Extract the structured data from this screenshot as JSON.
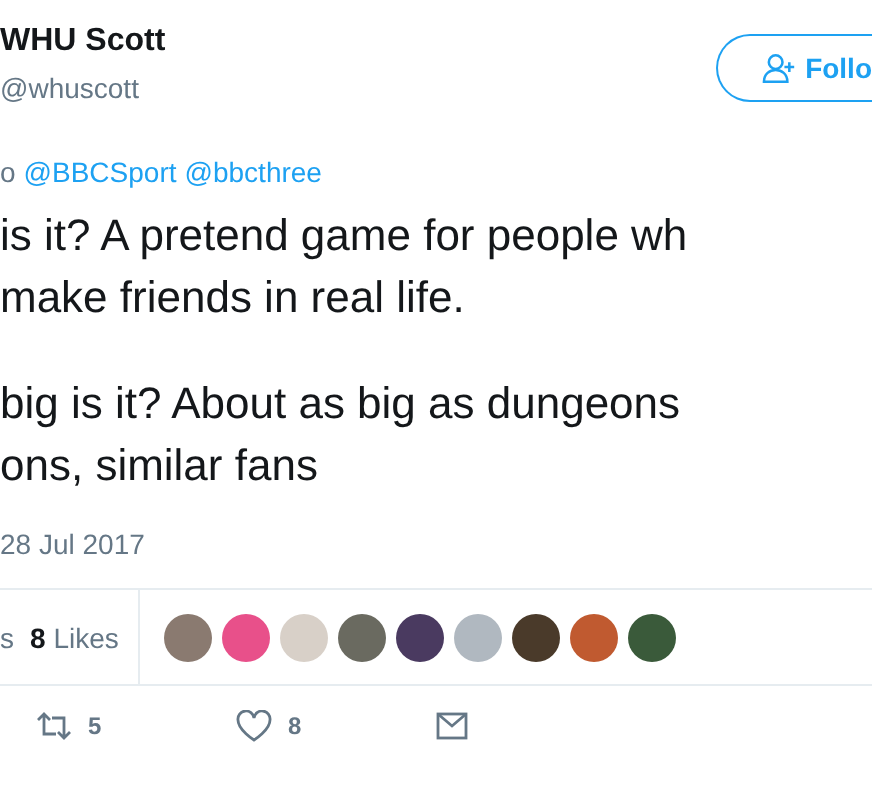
{
  "author": {
    "name": "WHU Scott",
    "handle": "@whuscott"
  },
  "follow_button": {
    "label": "Follo"
  },
  "reply_to": {
    "prefix": "o",
    "mentions": [
      "@BBCSport",
      "@bbcthree"
    ]
  },
  "tweet_lines": [
    [
      "is it? A pretend game for people wh",
      "make friends in real life."
    ],
    [
      "big is it? About as big as dungeons",
      "ons, similar fans"
    ]
  ],
  "date": "28 Jul 2017",
  "stats": {
    "retweets_suffix": "s",
    "likes_count": "8",
    "likes_label": "Likes"
  },
  "likers": [
    {
      "color": "#8a7a70"
    },
    {
      "color": "#e8508a"
    },
    {
      "color": "#d8d0c8"
    },
    {
      "color": "#6a6a60"
    },
    {
      "color": "#4a3a60"
    },
    {
      "color": "#b0b8c0"
    },
    {
      "color": "#4a3a2a"
    },
    {
      "color": "#c05a30"
    },
    {
      "color": "#3a5a3a"
    }
  ],
  "actions": [
    {
      "kind": "retweet",
      "count": "5"
    },
    {
      "kind": "like",
      "count": "8"
    },
    {
      "kind": "message"
    }
  ]
}
